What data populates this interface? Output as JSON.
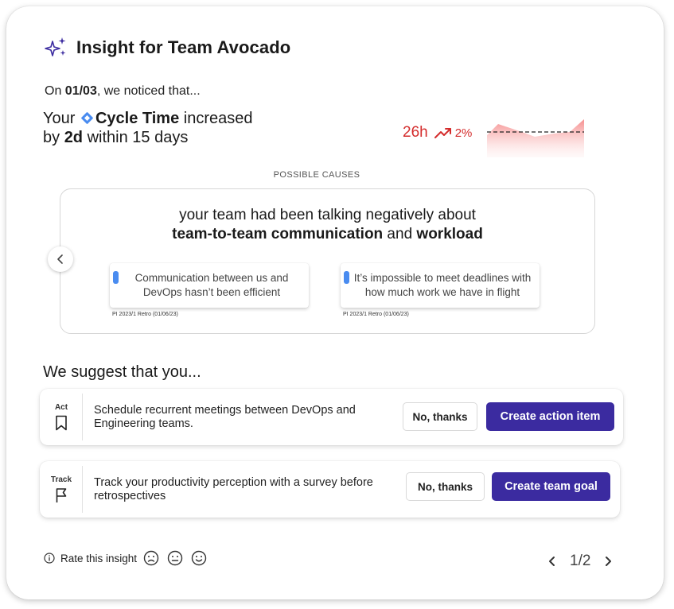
{
  "header": {
    "title": "Insight for Team Avocado",
    "icon": "sparkle-icon",
    "icon_color": "#3b2ba0"
  },
  "notice": {
    "prefix": "On ",
    "date": "01/03",
    "suffix": ", we noticed that..."
  },
  "headline": {
    "line1_prefix": "Your ",
    "metric_name": "Cycle Time",
    "line1_suffix": " increased",
    "line2_prefix": "by ",
    "amount": "2d",
    "line2_suffix": " within 15 days"
  },
  "metric": {
    "value": "26h",
    "change": "2%",
    "trend_icon": "trend-up-icon",
    "color": "#d42c2c"
  },
  "causes": {
    "label": "POSSIBLE CAUSES",
    "intro": "your team had been talking negatively about",
    "topic1": "team-to-team communication",
    "joiner": " and ",
    "topic2": "workload",
    "quotes": [
      {
        "text": "Communication between us and DevOps hasn’t been efficient",
        "source": "PI 2023/1 Retro (01/06/23)"
      },
      {
        "text": "It’s impossible to meet deadlines with how much work we have in flight",
        "source": "PI 2023/1 Retro (01/06/23)"
      }
    ]
  },
  "suggest": {
    "heading": "We suggest that you..."
  },
  "actions": [
    {
      "kind": "Act",
      "icon": "bookmark-icon",
      "text": "Schedule recurrent meetings between DevOps and Engineering teams.",
      "decline_label": "No, thanks",
      "primary_label": "Create action item"
    },
    {
      "kind": "Track",
      "icon": "flag-icon",
      "text": "Track your productivity perception with a survey before retrospectives",
      "decline_label": "No, thanks",
      "primary_label": "Create team goal"
    }
  ],
  "rating": {
    "label": "Rate this insight",
    "icons": [
      "sad-face-icon",
      "neutral-face-icon",
      "happy-face-icon"
    ]
  },
  "pager": {
    "text": "1/2"
  },
  "colors": {
    "primary": "#3b2ba0",
    "accent_blue": "#4a8cf0",
    "negative": "#d42c2c"
  }
}
